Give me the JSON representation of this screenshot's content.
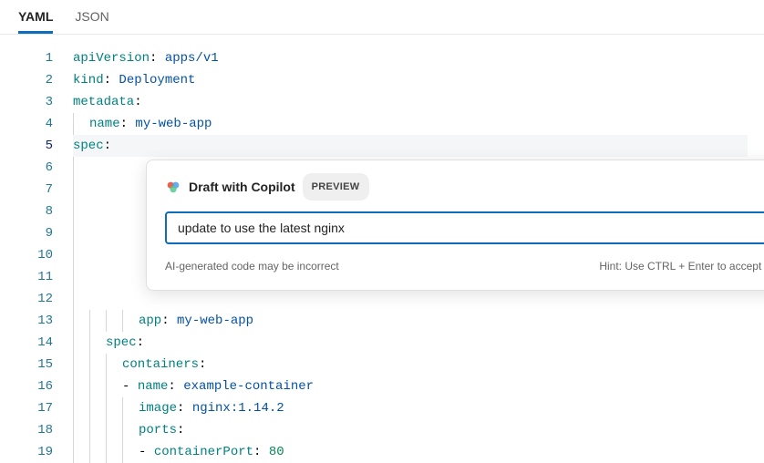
{
  "tabs": {
    "yaml": "YAML",
    "json": "JSON"
  },
  "editor": {
    "lines": [
      {
        "n": 1,
        "indent": 0,
        "seg": [
          {
            "c": "k",
            "t": "apiVersion"
          },
          {
            "c": "p",
            "t": ": "
          },
          {
            "c": "s",
            "t": "apps/v1"
          }
        ]
      },
      {
        "n": 2,
        "indent": 0,
        "seg": [
          {
            "c": "k",
            "t": "kind"
          },
          {
            "c": "p",
            "t": ": "
          },
          {
            "c": "s",
            "t": "Deployment"
          }
        ]
      },
      {
        "n": 3,
        "indent": 0,
        "seg": [
          {
            "c": "k",
            "t": "metadata"
          },
          {
            "c": "p",
            "t": ":"
          }
        ]
      },
      {
        "n": 4,
        "indent": 1,
        "seg": [
          {
            "c": "k",
            "t": "name"
          },
          {
            "c": "p",
            "t": ": "
          },
          {
            "c": "s",
            "t": "my-web-app"
          }
        ]
      },
      {
        "n": 5,
        "indent": 0,
        "current": true,
        "seg": [
          {
            "c": "k",
            "t": "spec"
          },
          {
            "c": "p",
            "t": ":"
          }
        ]
      },
      {
        "n": 6,
        "indent": 1,
        "blank": true,
        "seg": []
      },
      {
        "n": 7,
        "indent": 1,
        "blank": true,
        "seg": []
      },
      {
        "n": 8,
        "indent": 1,
        "blank": true,
        "seg": []
      },
      {
        "n": 9,
        "indent": 1,
        "blank": true,
        "seg": []
      },
      {
        "n": 10,
        "indent": 1,
        "blank": true,
        "seg": []
      },
      {
        "n": 11,
        "indent": 1,
        "blank": true,
        "seg": []
      },
      {
        "n": 12,
        "indent": 1,
        "blank": true,
        "seg": []
      },
      {
        "n": 13,
        "indent": 4,
        "seg": [
          {
            "c": "k",
            "t": "app"
          },
          {
            "c": "p",
            "t": ": "
          },
          {
            "c": "s",
            "t": "my-web-app"
          }
        ]
      },
      {
        "n": 14,
        "indent": 2,
        "seg": [
          {
            "c": "k",
            "t": "spec"
          },
          {
            "c": "p",
            "t": ":"
          }
        ]
      },
      {
        "n": 15,
        "indent": 3,
        "seg": [
          {
            "c": "k",
            "t": "containers"
          },
          {
            "c": "p",
            "t": ":"
          }
        ]
      },
      {
        "n": 16,
        "indent": 3,
        "seg": [
          {
            "c": "d",
            "t": "- "
          },
          {
            "c": "k",
            "t": "name"
          },
          {
            "c": "p",
            "t": ": "
          },
          {
            "c": "s",
            "t": "example-container"
          }
        ]
      },
      {
        "n": 17,
        "indent": 4,
        "seg": [
          {
            "c": "k",
            "t": "image"
          },
          {
            "c": "p",
            "t": ": "
          },
          {
            "c": "s",
            "t": "nginx:1.14.2"
          }
        ]
      },
      {
        "n": 18,
        "indent": 4,
        "seg": [
          {
            "c": "k",
            "t": "ports"
          },
          {
            "c": "p",
            "t": ":"
          }
        ]
      },
      {
        "n": 19,
        "indent": 4,
        "seg": [
          {
            "c": "d",
            "t": "- "
          },
          {
            "c": "k",
            "t": "containerPort"
          },
          {
            "c": "p",
            "t": ": "
          },
          {
            "c": "n",
            "t": "80"
          }
        ]
      }
    ]
  },
  "popup": {
    "title": "Draft with Copilot",
    "badge": "PREVIEW",
    "input_value": "update to use the latest nginx",
    "disclaimer": "AI-generated code may be incorrect",
    "hint": "Hint: Use CTRL + Enter to accept changes"
  }
}
